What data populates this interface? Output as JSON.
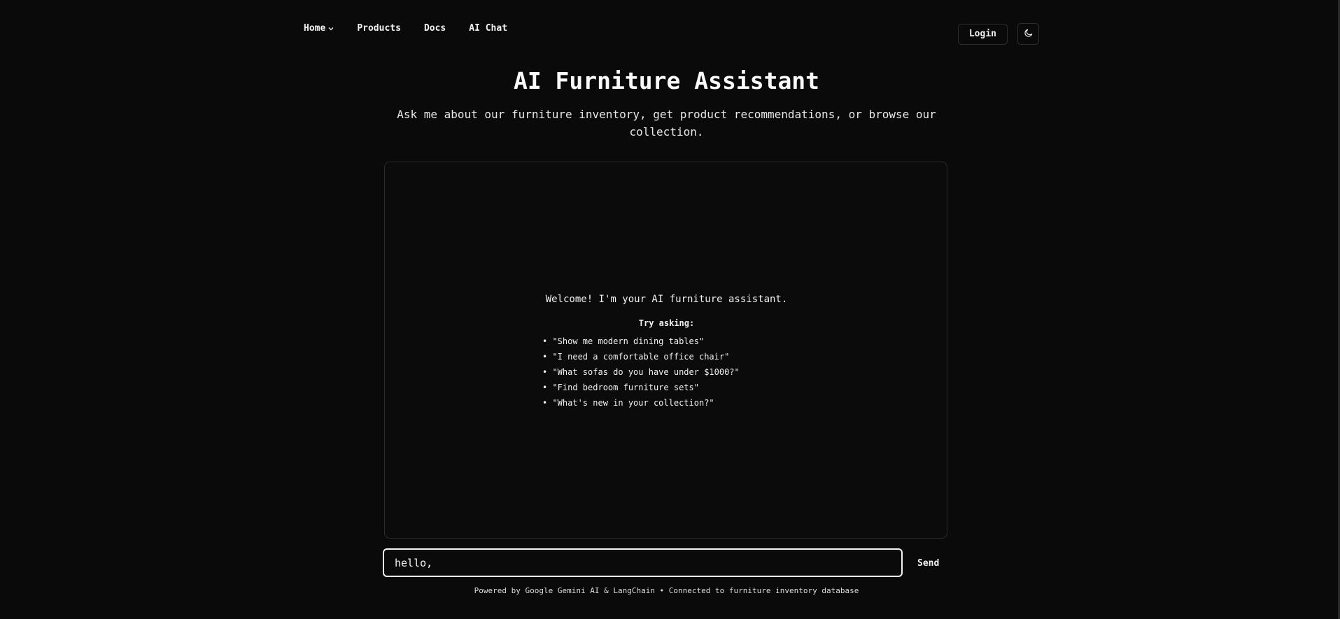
{
  "nav": {
    "items": [
      {
        "label": "Home",
        "has_dropdown": true
      },
      {
        "label": "Products",
        "has_dropdown": false
      },
      {
        "label": "Docs",
        "has_dropdown": false
      },
      {
        "label": "AI Chat",
        "has_dropdown": false
      }
    ],
    "login_label": "Login",
    "theme_icon": "moon-icon"
  },
  "hero": {
    "title": "AI Furniture Assistant",
    "subtitle": "Ask me about our furniture inventory, get product recommendations, or browse our collection."
  },
  "chat": {
    "welcome": "Welcome! I'm your AI furniture assistant.",
    "try_label": "Try asking:",
    "suggestions": [
      "• \"Show me modern dining tables\"",
      "• \"I need a comfortable office chair\"",
      "• \"What sofas do you have under $1000?\"",
      "• \"Find bedroom furniture sets\"",
      "• \"What's new in your collection?\""
    ]
  },
  "input": {
    "value": "hello, ",
    "send_label": "Send"
  },
  "footer": {
    "note": "Powered by Google Gemini AI & LangChain • Connected to furniture inventory database"
  },
  "colors": {
    "background": "#0a0a0a",
    "text": "#f2f2f2",
    "border": "#2c2c2c"
  }
}
